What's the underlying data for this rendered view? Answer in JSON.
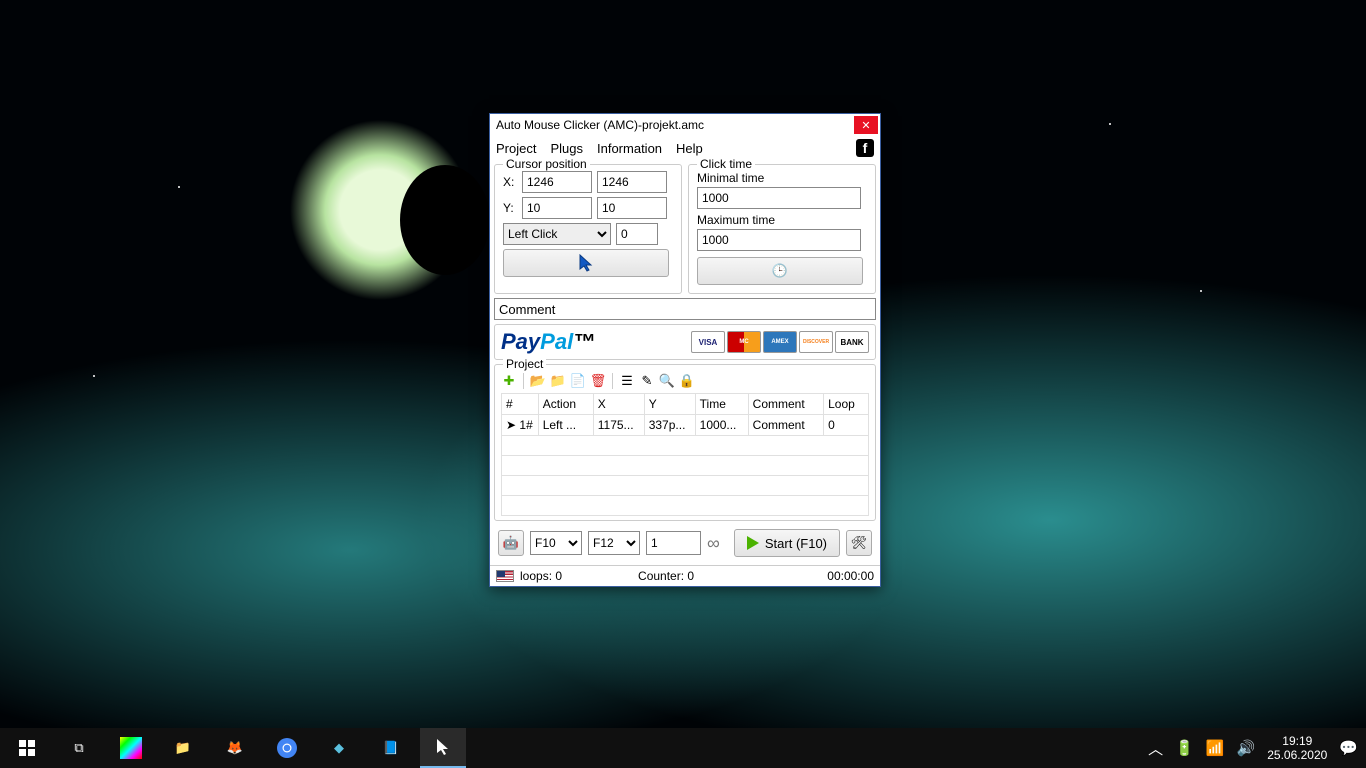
{
  "window": {
    "title": "Auto Mouse Clicker (AMC)-projekt.amc",
    "menu": {
      "project": "Project",
      "plugs": "Plugs",
      "information": "Information",
      "help": "Help"
    }
  },
  "cursor": {
    "legend": "Cursor position",
    "x_label": "X:",
    "x1": "1246",
    "x2": "1246",
    "y_label": "Y:",
    "y1": "10",
    "y2": "10",
    "click_type": "Left Click",
    "delay": "0"
  },
  "click_time": {
    "legend": "Click time",
    "min_label": "Minimal time",
    "min": "1000",
    "max_label": "Maximum time",
    "max": "1000"
  },
  "comment": {
    "placeholder": "Comment"
  },
  "paypal": {
    "visa": "VISA",
    "mc": "MC",
    "amex": "AMEX",
    "disc": "DISCOVER",
    "bank": "BANK"
  },
  "project": {
    "legend": "Project",
    "headers": {
      "num": "#",
      "action": "Action",
      "x": "X",
      "y": "Y",
      "time": "Time",
      "comment": "Comment",
      "loop": "Loop"
    },
    "rows": [
      {
        "num": "1#",
        "action": "Left ...",
        "x": "1175...",
        "y": "337p...",
        "time": "1000...",
        "comment": "Comment",
        "loop": "0"
      }
    ]
  },
  "controls": {
    "hk1": "F10",
    "hk2": "F12",
    "loops": "1",
    "start_label": "Start (F10)"
  },
  "status": {
    "loops": "loops: 0",
    "counter": "Counter: 0",
    "time": "00:00:00"
  },
  "taskbar": {
    "time": "19:19",
    "date": "25.06.2020"
  }
}
